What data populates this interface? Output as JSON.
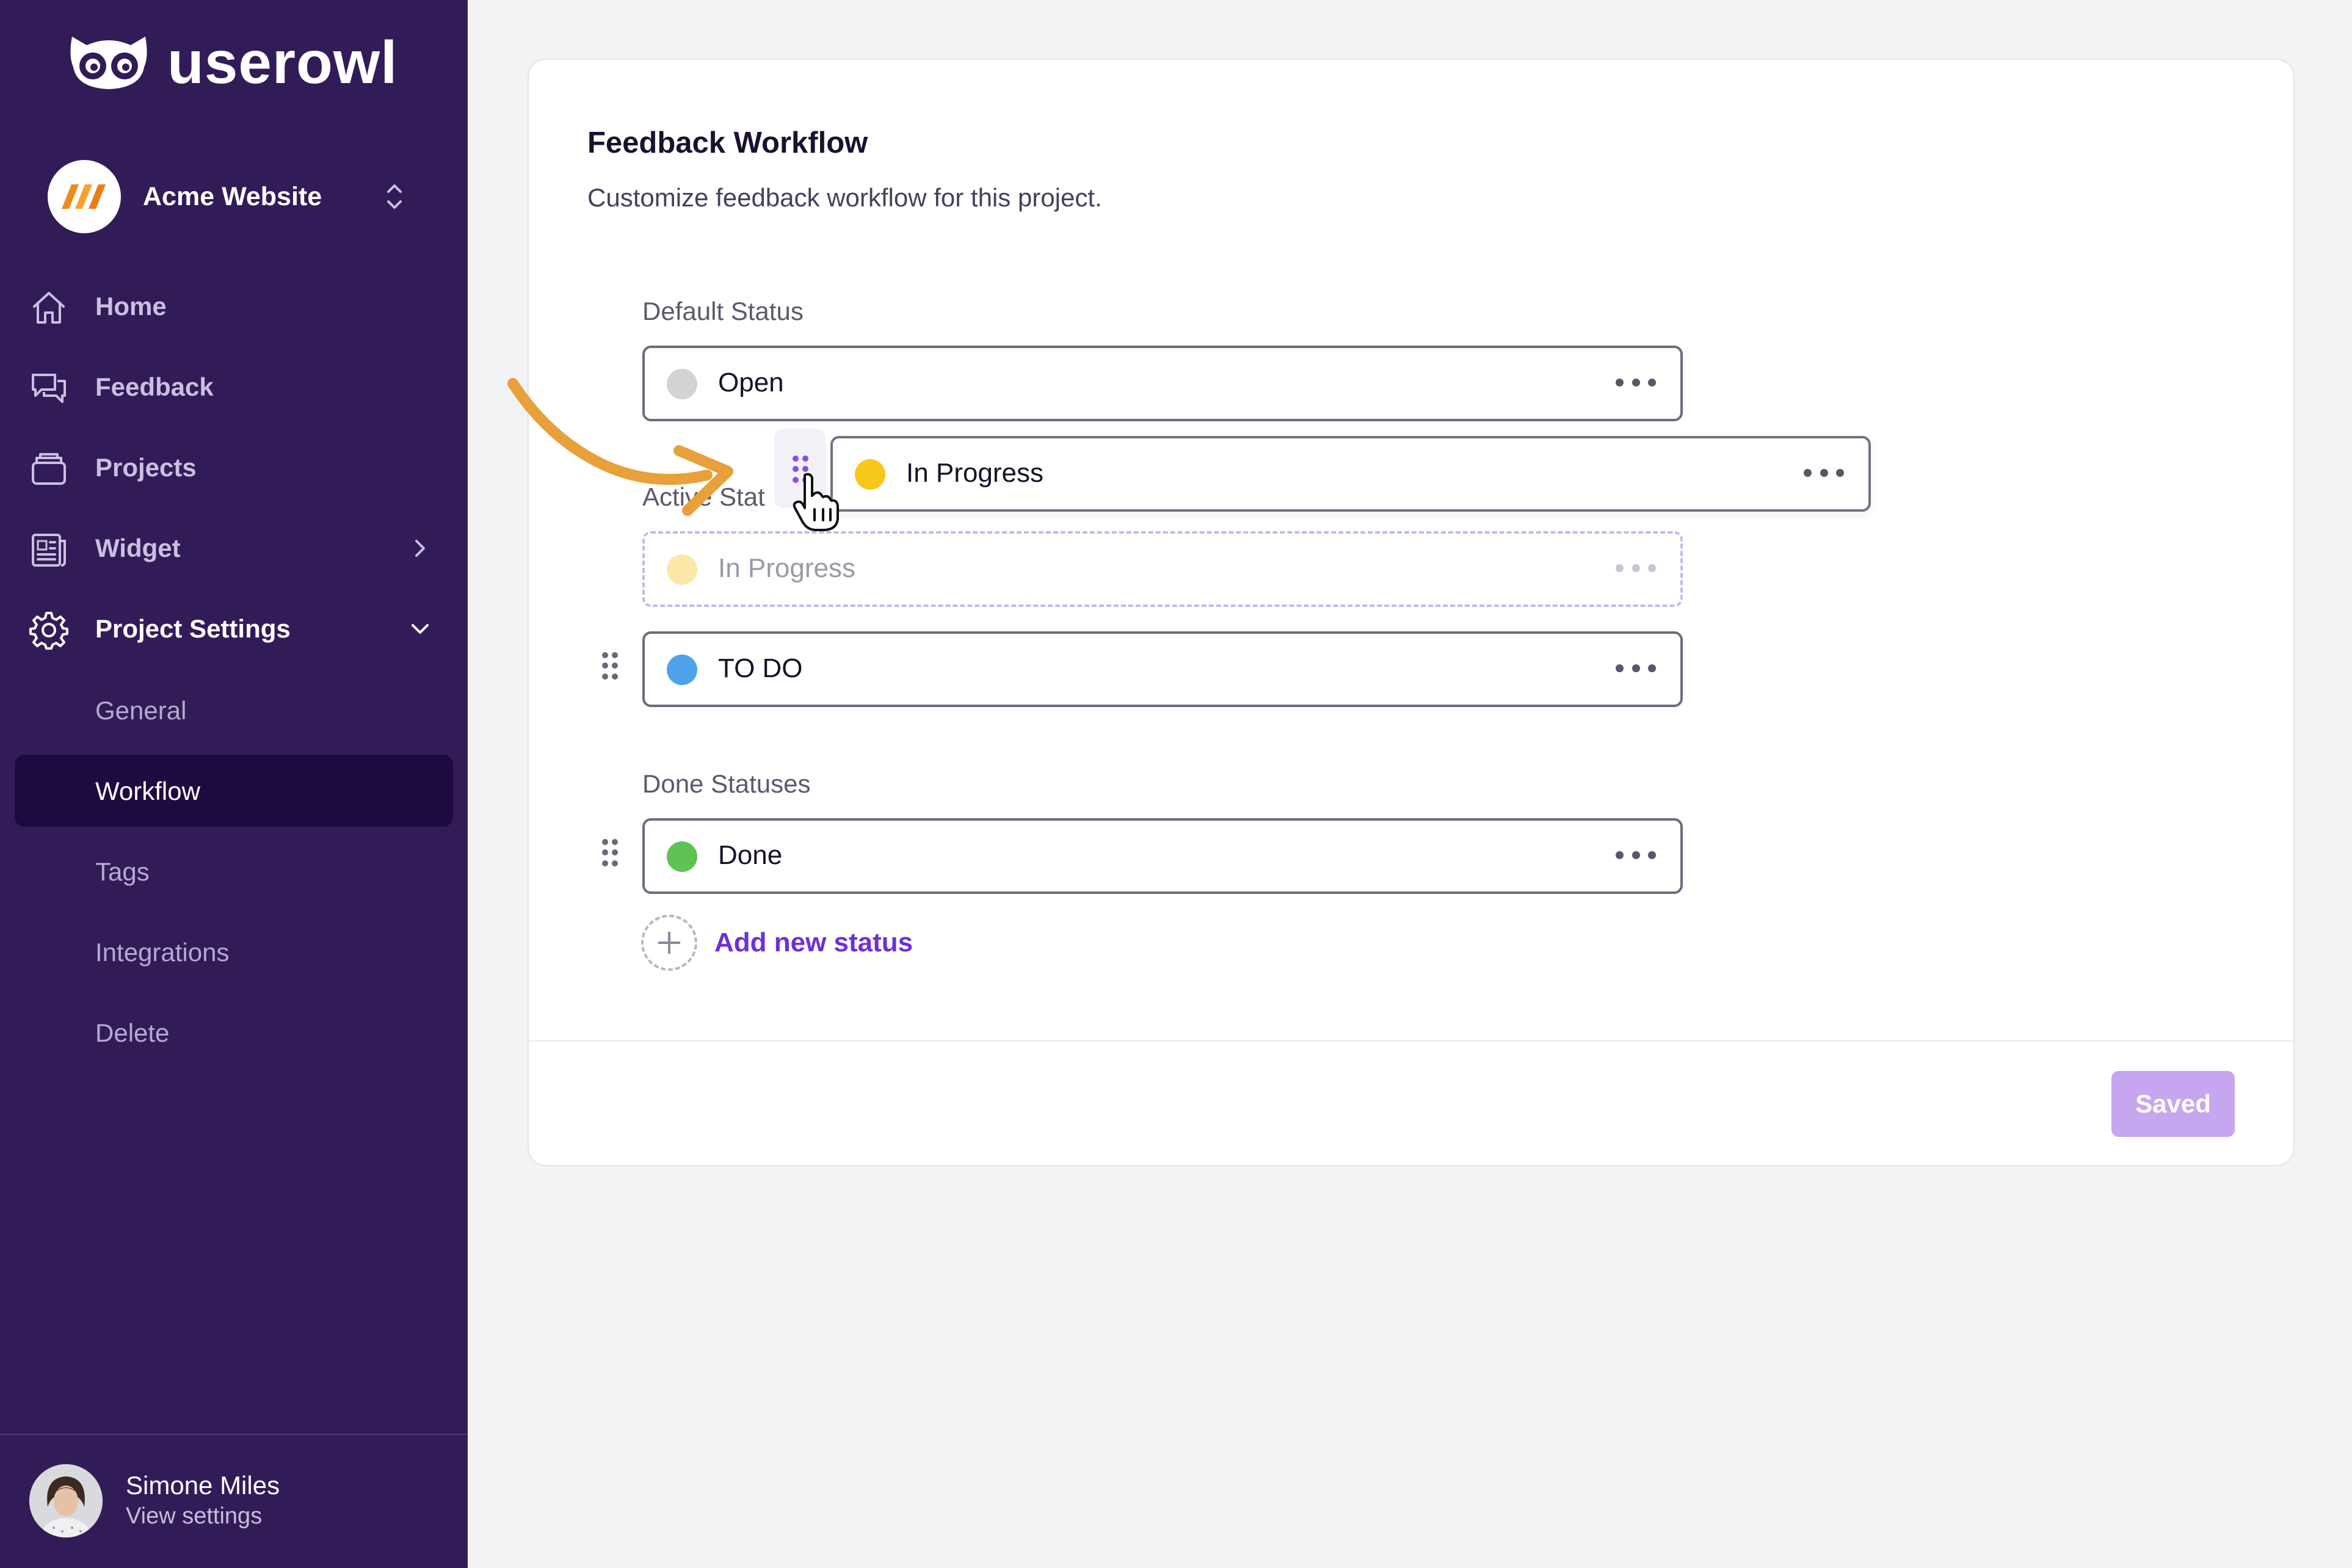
{
  "app": {
    "brand": "userowl"
  },
  "project": {
    "name": "Acme Website"
  },
  "nav": {
    "home": "Home",
    "feedback": "Feedback",
    "projects": "Projects",
    "widget": "Widget",
    "project_settings": "Project Settings",
    "sub": {
      "general": "General",
      "workflow": "Workflow",
      "tags": "Tags",
      "integrations": "Integrations",
      "delete": "Delete"
    }
  },
  "user": {
    "name": "Simone Miles",
    "sub": "View settings"
  },
  "page": {
    "title": "Feedback Workflow",
    "subtitle": "Customize feedback workflow for this project."
  },
  "sections": {
    "default": "Default Status",
    "active": "Active Stat",
    "done": "Done Statuses"
  },
  "statuses": {
    "open": {
      "name": "Open",
      "color": "#d3d3d6"
    },
    "dragging": {
      "name": "In Progress",
      "color": "#f7c81a"
    },
    "placeholder": {
      "name": "In Progress",
      "color": "#fbe8a8"
    },
    "todo": {
      "name": "TO DO",
      "color": "#4da3ea"
    },
    "done": {
      "name": "Done",
      "color": "#5ec255"
    }
  },
  "actions": {
    "add_status": "Add new status",
    "save": "Saved"
  },
  "colors": {
    "sidebar": "#311c58",
    "accent": "#6d2fd8",
    "arrow": "#e8a03a",
    "saved_button": "#c7a6f0"
  }
}
